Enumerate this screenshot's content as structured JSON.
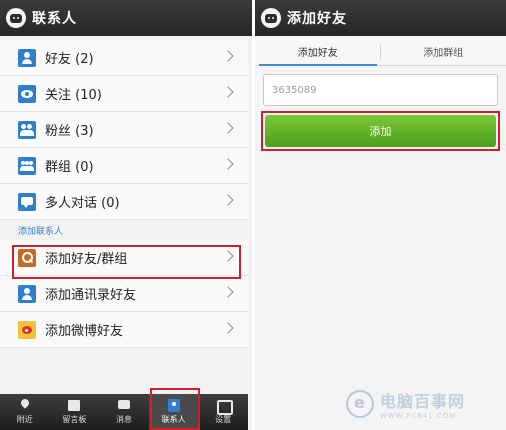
{
  "left": {
    "title": "联系人",
    "items": [
      {
        "label": "好友 (2)",
        "icon": "friends-icon"
      },
      {
        "label": "关注 (10)",
        "icon": "follow-icon"
      },
      {
        "label": "粉丝 (3)",
        "icon": "fans-icon"
      },
      {
        "label": "群组 (0)",
        "icon": "group-icon"
      },
      {
        "label": "多人对话 (0)",
        "icon": "multi-chat-icon"
      }
    ],
    "section_label": "添加联系人",
    "add_items": [
      {
        "label": "添加好友/群组",
        "icon": "search-icon"
      },
      {
        "label": "添加通讯录好友",
        "icon": "address-book-icon"
      },
      {
        "label": "添加微博好友",
        "icon": "weibo-icon"
      }
    ],
    "tabbar": [
      {
        "label": "附近",
        "icon": "location-pin-icon"
      },
      {
        "label": "留言板",
        "icon": "message-board-icon"
      },
      {
        "label": "消息",
        "icon": "message-icon"
      },
      {
        "label": "联系人",
        "icon": "contacts-icon"
      },
      {
        "label": "设置",
        "icon": "settings-icon"
      }
    ]
  },
  "right": {
    "title": "添加好友",
    "tabs": [
      "添加好友",
      "添加群组"
    ],
    "input_value": "3635089",
    "add_button": "添加"
  },
  "watermark": {
    "name": "电脑百事网",
    "url": "WWW.PC841.COM"
  },
  "colors": {
    "highlight": "#d0202a",
    "accent_blue": "#3a8fd6",
    "button_green": "#5aae24"
  }
}
